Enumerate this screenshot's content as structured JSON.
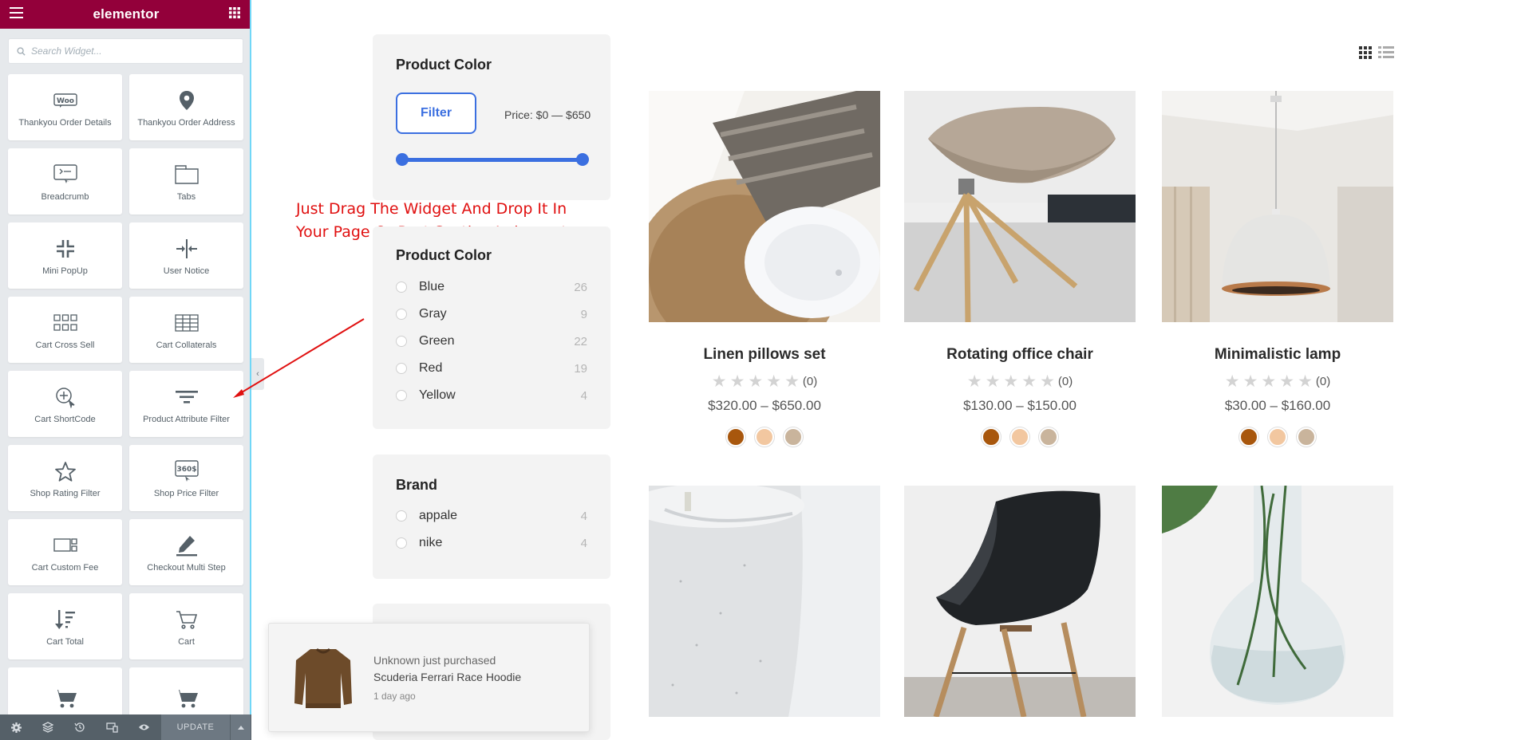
{
  "editor": {
    "logo": "elementor",
    "search_placeholder": "Search Widget...",
    "widgets": [
      {
        "label": "Thankyou Order Details",
        "icon": "woo-icon"
      },
      {
        "label": "Thankyou Order Address",
        "icon": "map-pin-icon"
      },
      {
        "label": "Breadcrumb",
        "icon": "breadcrumb-icon"
      },
      {
        "label": "Tabs",
        "icon": "tabs-icon"
      },
      {
        "label": "Mini PopUp",
        "icon": "minimize-icon"
      },
      {
        "label": "User Notice",
        "icon": "split-arrows-icon"
      },
      {
        "label": "Cart Cross Sell",
        "icon": "grid-icon"
      },
      {
        "label": "Cart Collaterals",
        "icon": "table-icon"
      },
      {
        "label": "Cart ShortCode",
        "icon": "zoom-plus-icon"
      },
      {
        "label": "Product Attribute Filter",
        "icon": "filter-lines-icon"
      },
      {
        "label": "Shop Rating Filter",
        "icon": "star-outline-icon"
      },
      {
        "label": "Shop Price Filter",
        "icon": "price-360-icon"
      },
      {
        "label": "Cart Custom Fee",
        "icon": "card-fee-icon"
      },
      {
        "label": "Checkout Multi Step",
        "icon": "pencil-icon"
      },
      {
        "label": "Cart Total",
        "icon": "sort-down-icon"
      },
      {
        "label": "Cart",
        "icon": "cart-outline-icon"
      },
      {
        "label": "",
        "icon": "cart-solid-icon"
      },
      {
        "label": "",
        "icon": "cart-solid-icon"
      }
    ],
    "footer": {
      "update_label": "UPDATE"
    }
  },
  "filters": {
    "card1": {
      "title": "Product Color",
      "button": "Filter",
      "price": "Price: $0 — $650"
    },
    "card2": {
      "title": "Product Color",
      "options": [
        {
          "label": "Blue",
          "count": "26"
        },
        {
          "label": "Gray",
          "count": "9"
        },
        {
          "label": "Green",
          "count": "22"
        },
        {
          "label": "Red",
          "count": "19"
        },
        {
          "label": "Yellow",
          "count": "4"
        }
      ]
    },
    "card3": {
      "title": "Brand",
      "options": [
        {
          "label": "appale",
          "count": "4"
        },
        {
          "label": "nike",
          "count": "4"
        }
      ]
    }
  },
  "annotation": {
    "line1": "Just Drag The Widget And Drop It In",
    "line2": "Your Page Or Post Section I elementor"
  },
  "products": [
    {
      "name": "Linen pillows set",
      "rating": "(0)",
      "price": "$320.00 – $650.00"
    },
    {
      "name": "Rotating office chair",
      "rating": "(0)",
      "price": "$130.00 – $150.00"
    },
    {
      "name": "Minimalistic lamp",
      "rating": "(0)",
      "price": "$30.00 – $160.00"
    }
  ],
  "swatch_colors": [
    "#a8570d",
    "#f2c7a0",
    "#c9b49c"
  ],
  "notification": {
    "line1": "Unknown just purchased",
    "line2": "Scuderia Ferrari Race Hoodie",
    "line3": "1 day ago"
  },
  "colors": {
    "brand": "#93003a",
    "accent": "#3b6fe0",
    "annotation": "#e01010"
  }
}
